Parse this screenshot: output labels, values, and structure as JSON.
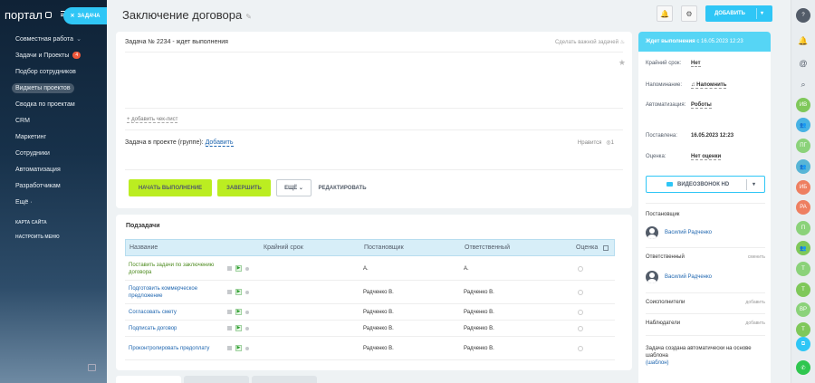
{
  "sidebar": {
    "logo": "портал",
    "task_chip": "ЗАДАЧА",
    "items": [
      {
        "label": "Совместная работа",
        "chevron": "⌄"
      },
      {
        "label": "Задачи и Проекты",
        "badge": "4"
      },
      {
        "label": "Подбор сотрудников"
      },
      {
        "label": "Виджеты проектов",
        "active": true
      },
      {
        "label": "Сводка по проектам"
      },
      {
        "label": "CRM"
      },
      {
        "label": "Маркетинг"
      },
      {
        "label": "Сотрудники"
      },
      {
        "label": "Автоматизация"
      },
      {
        "label": "Разработчикам"
      },
      {
        "label": "Ещё ·"
      }
    ],
    "sitemap": "КАРТА САЙТА",
    "settings": "НАСТРОИТЬ МЕНЮ"
  },
  "header": {
    "title": "Заключение договора",
    "add_button": "ДОБАВИТЬ"
  },
  "task": {
    "heading": "Задача № 2234 - ждет выполнения",
    "make_important": "Сделать важной задачей",
    "add_checklist": "+ добавить чек-лист",
    "project_label": "Задача в проекте (группе):",
    "project_add": "Добавить",
    "likes": "Нравится",
    "likes_count": "1",
    "buttons": {
      "start": "НАЧАТЬ ВЫПОЛНЕНИЕ",
      "finish": "ЗАВЕРШИТЬ",
      "more": "ЕЩЁ",
      "edit": "РЕДАКТИРОВАТЬ"
    }
  },
  "subtasks": {
    "title": "Подзадачи",
    "columns": [
      "Название",
      "Крайний срок",
      "Постановщик",
      "Ответственный",
      "Оценка"
    ],
    "rows": [
      {
        "name": "Поставить задачи по заключению договора",
        "creator": "А.",
        "responsible": "А.",
        "completed_style": true
      },
      {
        "name": "Подготовить коммерческое предложение",
        "creator": "Радченко В.",
        "responsible": "Радченко В."
      },
      {
        "name": "Согласовать смету",
        "creator": "Радченко В.",
        "responsible": "Радченко В."
      },
      {
        "name": "Подписать договор",
        "creator": "Радченко В.",
        "responsible": "Радченко В."
      },
      {
        "name": "Проконтролировать предоплату",
        "creator": "Радченко В.",
        "responsible": "Радченко В."
      }
    ]
  },
  "side": {
    "status": "Ждет выполнения",
    "status_date": "с 16.05.2023 12:23",
    "deadline_label": "Крайний срок:",
    "deadline_value": "Нет",
    "reminder_label": "Напоминание:",
    "reminder_value": "Напомнить",
    "automation_label": "Автоматизация:",
    "automation_value": "Роботы",
    "created_label": "Поставлена:",
    "created_value": "16.05.2023 12:23",
    "rating_label": "Оценка:",
    "rating_value": "Нет оценки",
    "video": "ВИДЕОЗВОНОК HD",
    "creator_title": "Постановщик",
    "creator_name": "Василий Радченко",
    "responsible_title": "Ответственный",
    "responsible_action": "сменить",
    "responsible_name": "Василий Радченко",
    "coexec_title": "Соисполнители",
    "coexec_action": "добавить",
    "observers_title": "Наблюдатели",
    "observers_action": "добавить",
    "auto_note": "Задача создана автоматически на основе шаблона",
    "template_link": "(шаблон)"
  },
  "right_bar": [
    {
      "icon": "help-icon",
      "glyph": "?",
      "color": "#535c69"
    },
    {
      "icon": "bell-icon",
      "glyph": "🔔",
      "color": ""
    },
    {
      "icon": "chat-icon",
      "glyph": "@",
      "color": ""
    },
    {
      "icon": "search-icon",
      "glyph": "⌕",
      "color": ""
    },
    {
      "icon": "avatar-iv",
      "glyph": "ИВ",
      "color": "#7fc85a"
    },
    {
      "icon": "group-icon",
      "glyph": "👥",
      "color": "#47b2e4"
    },
    {
      "icon": "avatar-pg",
      "glyph": "ПГ",
      "color": "#8bd27a"
    },
    {
      "icon": "group-icon",
      "glyph": "👥",
      "color": "#58b5d6"
    },
    {
      "icon": "avatar-ib",
      "glyph": "ИБ",
      "color": "#ee7f61"
    },
    {
      "icon": "avatar-ra",
      "glyph": "РА",
      "color": "#ee7f61"
    },
    {
      "icon": "avatar-p",
      "glyph": "П",
      "color": "#8bd27a"
    },
    {
      "icon": "group-icon",
      "glyph": "👥",
      "color": "#7fc85a"
    },
    {
      "icon": "avatar-t",
      "glyph": "Т",
      "color": "#8bd27a"
    },
    {
      "icon": "avatar-t2",
      "glyph": "Т",
      "color": "#7fc85a"
    },
    {
      "icon": "avatar-vr",
      "glyph": "ВР",
      "color": "#8bd27a"
    },
    {
      "icon": "avatar-t3",
      "glyph": "Т",
      "color": "#7fc85a"
    },
    {
      "icon": "copy-icon",
      "glyph": "⧉",
      "color": "#2fc6f6"
    },
    {
      "icon": "phone-icon",
      "glyph": "✆",
      "color": "#2fc64f"
    }
  ],
  "colors": {
    "accent": "#2fc6f6",
    "green_button": "#bbed21",
    "status_bar": "#56d5f5"
  }
}
